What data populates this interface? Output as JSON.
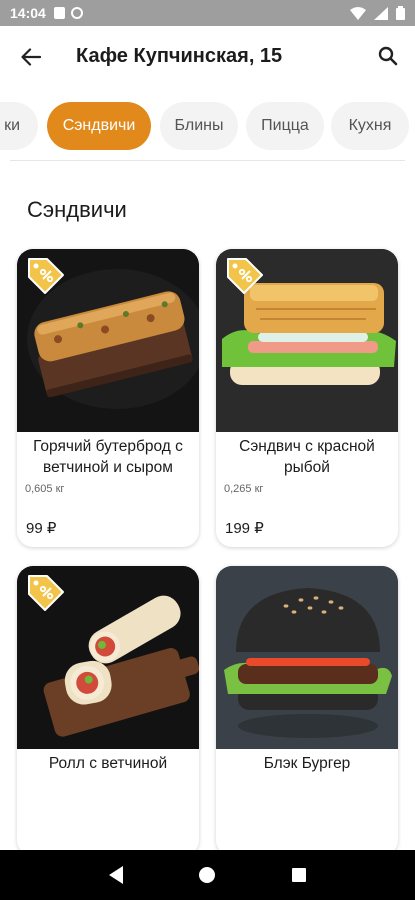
{
  "status_bar": {
    "time": "14:04"
  },
  "header": {
    "title": "Кафе Купчинская, 15"
  },
  "categories": [
    {
      "label": "ки"
    },
    {
      "label": "Сэндвичи",
      "active": true
    },
    {
      "label": "Блины"
    },
    {
      "label": "Пицца"
    },
    {
      "label": "Кухня"
    }
  ],
  "section": {
    "title": "Сэндвичи"
  },
  "products": [
    {
      "name": "Горячий бутерброд с ветчиной и сыром",
      "weight": "0,605 кг",
      "price": "99 ₽",
      "has_tag": true
    },
    {
      "name": "Сэндвич с красной рыбой",
      "weight": "0,265 кг",
      "price": "199 ₽",
      "has_tag": true
    },
    {
      "name": "Ролл с ветчиной",
      "weight": "",
      "price": "",
      "has_tag": true
    },
    {
      "name": "Блэк Бургер",
      "weight": "",
      "price": "",
      "has_tag": false
    }
  ],
  "colors": {
    "accent": "#e2891c",
    "tag": "#f3c44a",
    "status_bar": "#9e9e9e"
  }
}
